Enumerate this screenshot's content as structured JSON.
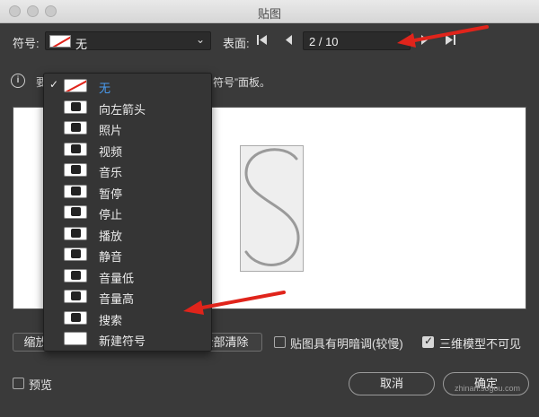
{
  "window": {
    "title": "贴图"
  },
  "top": {
    "symbol_label": "符号:",
    "symbol_value": "无",
    "surface_label": "表面:",
    "page_value": "2 / 10"
  },
  "info": {
    "text_left": "要",
    "text_right": "符号”面板。"
  },
  "menu": {
    "items": [
      {
        "label": "无",
        "icon": "none-icon",
        "selected": true
      },
      {
        "label": "向左箭头",
        "icon": "left-arrow-icon"
      },
      {
        "label": "照片",
        "icon": "photo-icon"
      },
      {
        "label": "视频",
        "icon": "video-icon"
      },
      {
        "label": "音乐",
        "icon": "music-icon"
      },
      {
        "label": "暂停",
        "icon": "pause-icon"
      },
      {
        "label": "停止",
        "icon": "stop-icon"
      },
      {
        "label": "播放",
        "icon": "play-icon"
      },
      {
        "label": "静音",
        "icon": "mute-icon"
      },
      {
        "label": "音量低",
        "icon": "volume-low-icon"
      },
      {
        "label": "音量高",
        "icon": "volume-high-icon"
      },
      {
        "label": "搜索",
        "icon": "search-icon"
      },
      {
        "label": "新建符号",
        "icon": "new-symbol-icon"
      }
    ]
  },
  "buttons": {
    "fit": "缩放以适合",
    "clear": "清除",
    "clear_all": "全部清除",
    "shade_label": "贴图具有明暗调(较慢)",
    "invisible_label": "三维模型不可见",
    "preview_label": "预览",
    "cancel": "取消",
    "ok": "确定"
  },
  "watermark": "zhinan.sogou.com",
  "colors": {
    "accent": "#4a9cf0",
    "arrow": "#e0241b"
  }
}
